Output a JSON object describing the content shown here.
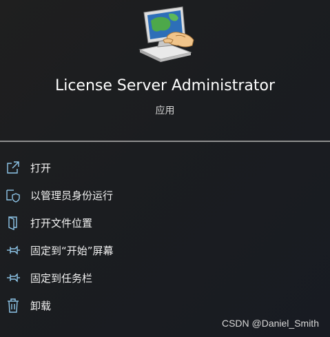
{
  "app": {
    "name": "License Server Administrator",
    "type": "应用",
    "icon": "computer-admin-icon"
  },
  "menu": {
    "items": [
      {
        "label": "打开",
        "icon": "open-external-icon"
      },
      {
        "label": "以管理员身份运行",
        "icon": "shield-icon"
      },
      {
        "label": "打开文件位置",
        "icon": "folder-icon"
      },
      {
        "label": "固定到“开始”屏幕",
        "icon": "pin-icon"
      },
      {
        "label": "固定到任务栏",
        "icon": "pin-icon"
      },
      {
        "label": "卸载",
        "icon": "trash-icon"
      }
    ]
  },
  "watermark": "CSDN @Daniel_Smith",
  "colors": {
    "background": "#1c1e22",
    "icon_accent": "#8fc7ea",
    "divider": "#8f8f8f"
  }
}
